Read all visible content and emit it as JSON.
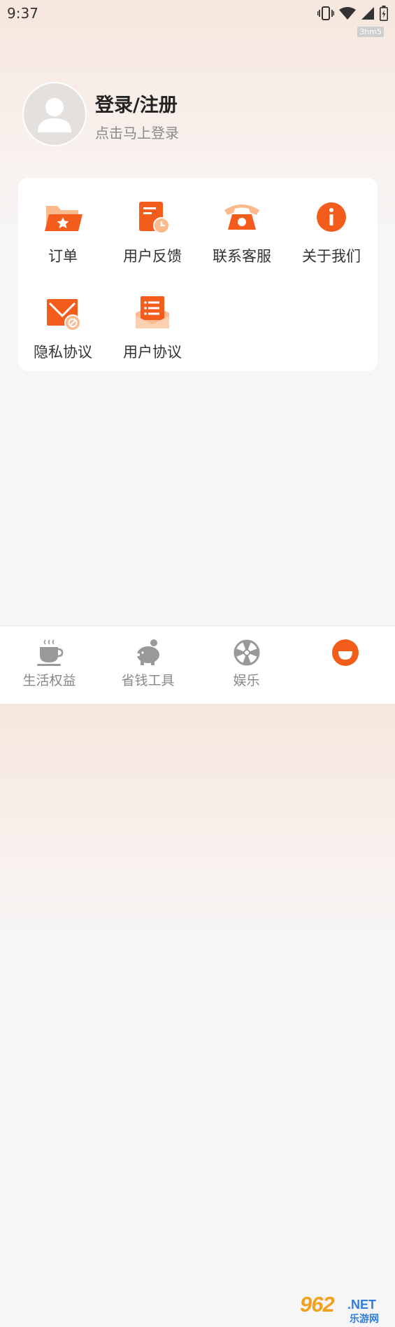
{
  "status_bar": {
    "time": "9:37",
    "watermark": "3hm5",
    "icons": [
      "vibrate-icon",
      "wifi-icon",
      "signal-icon",
      "battery-charging-icon"
    ]
  },
  "profile": {
    "title": "登录/注册",
    "subtitle": "点击马上登录",
    "avatar_icon": "user-avatar-icon"
  },
  "menu": {
    "items": [
      {
        "label": "订单",
        "icon": "folder-star-icon"
      },
      {
        "label": "用户反馈",
        "icon": "feedback-clock-icon"
      },
      {
        "label": "联系客服",
        "icon": "telephone-icon"
      },
      {
        "label": "关于我们",
        "icon": "info-icon"
      },
      {
        "label": "隐私协议",
        "icon": "privacy-envelope-icon"
      },
      {
        "label": "用户协议",
        "icon": "agreement-envelope-icon"
      }
    ]
  },
  "bottom_nav": {
    "items": [
      {
        "label": "生活权益",
        "icon": "coffee-cup-icon",
        "active": false
      },
      {
        "label": "省钱工具",
        "icon": "piggy-bank-icon",
        "active": false
      },
      {
        "label": "娱乐",
        "icon": "wheel-icon",
        "active": false
      },
      {
        "label": "",
        "icon": "smile-icon",
        "active": true
      }
    ]
  },
  "site_logo": {
    "number": "962",
    "suffix": ".NET",
    "subtitle": "乐游网"
  },
  "colors": {
    "accent": "#f45c1c",
    "accent_light": "#fbb98c",
    "nav_inactive": "#999999",
    "card_bg": "#ffffff"
  }
}
